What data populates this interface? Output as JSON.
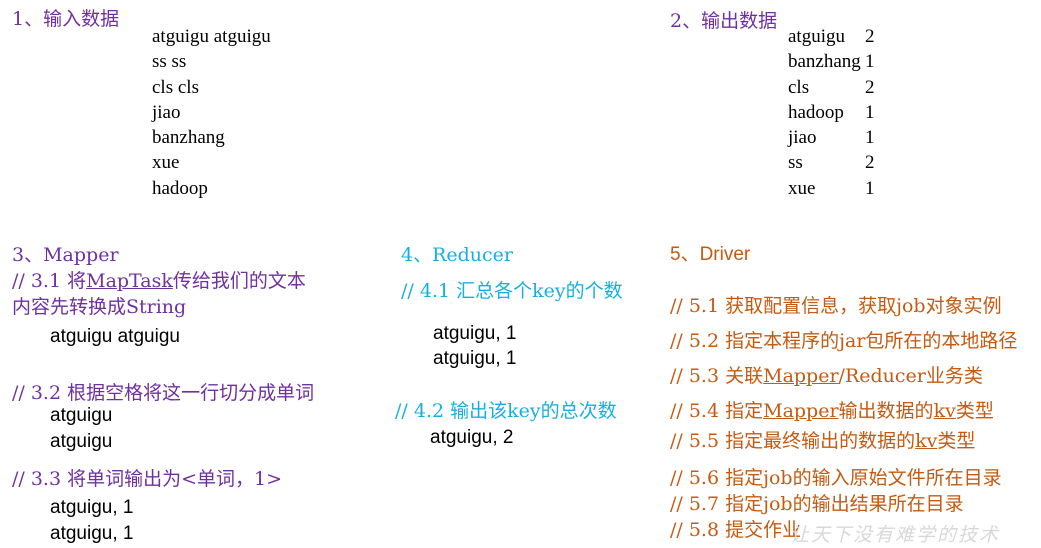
{
  "section1": {
    "title": "1、输入数据",
    "lines": [
      "atguigu atguigu",
      "ss ss",
      "cls cls",
      "jiao",
      "banzhang",
      "xue",
      "hadoop"
    ]
  },
  "section2": {
    "title": "2、输出数据",
    "keys": [
      "atguigu",
      "banzhang",
      "cls",
      "hadoop",
      "jiao",
      "ss",
      "xue"
    ],
    "counts": [
      "2",
      "1",
      "2",
      "1",
      "1",
      "2",
      "1"
    ]
  },
  "section3": {
    "title": "3、Mapper",
    "step1": {
      "prefix": "//  3.1  将",
      "link": "MapTask",
      "rest": "传给我们的文本",
      "line2": "内容先转换成String"
    },
    "step1_output": "atguigu atguigu",
    "step2": "// 3.2 根据空格将这一行切分成单词",
    "step2_output": [
      "atguigu",
      "atguigu"
    ],
    "step3": "// 3.3 将单词输出为<单词，1>",
    "step3_output": [
      "atguigu, 1",
      "atguigu, 1"
    ]
  },
  "section4": {
    "title": "4、Reducer",
    "step1": "// 4.1 汇总各个key的个数",
    "step1_output": [
      "atguigu, 1",
      "atguigu, 1"
    ],
    "step2": "// 4.2  输出该key的总次数",
    "step2_output": "atguigu, 2"
  },
  "section5": {
    "title": "5、Driver",
    "s1": "// 5.1 获取配置信息，获取job对象实例",
    "s2": "// 5.2 指定本程序的jar包所在的本地路径",
    "s3": {
      "prefix": "// 5.3 关联",
      "link": "Mapper",
      "rest": "/Reducer业务类"
    },
    "s4": {
      "prefix": "// 5.4 指定",
      "link": "Mapper",
      "mid": "输出数据的",
      "link2": "kv",
      "rest": "类型"
    },
    "s5": {
      "prefix": "// 5.5 指定最终输出的数据的",
      "link": "kv",
      "rest": "类型"
    },
    "s6": "// 5.6 指定job的输入原始文件所在目录",
    "s7": "// 5.7  指定job的输出结果所在目录",
    "s8": "// 5.8 提交作业"
  },
  "watermark": "让天下没有难学的技术",
  "colors": {
    "purple": "#7030a0",
    "cyan": "#16b0e0",
    "orange": "#c55a11"
  }
}
